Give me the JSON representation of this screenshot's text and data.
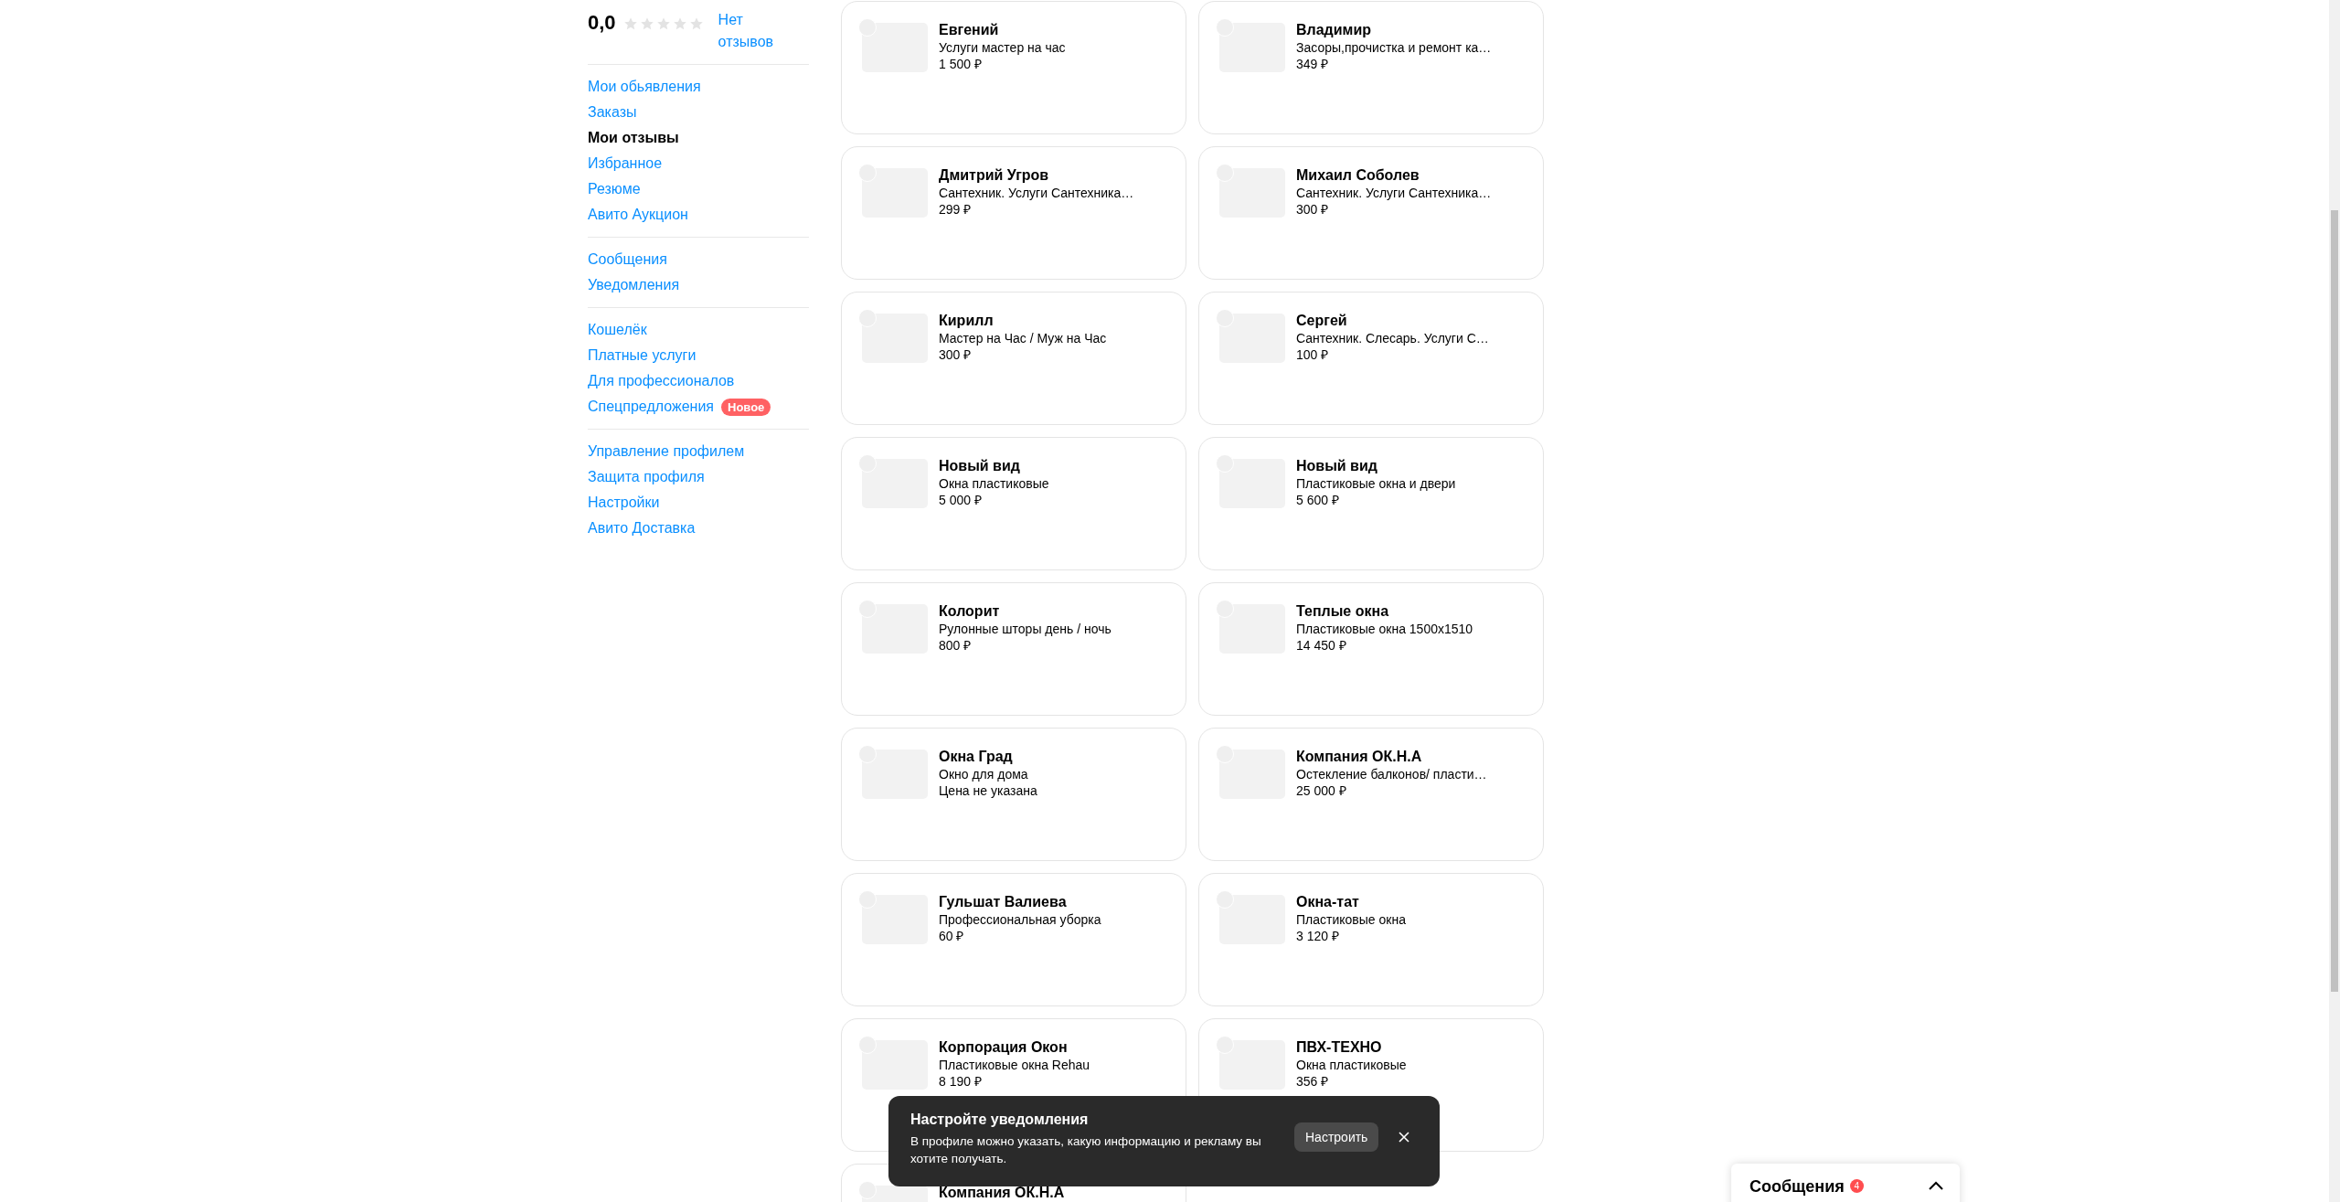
{
  "sidebar": {
    "rating": {
      "value": "0,0",
      "stars": 0,
      "link": "Нет отзывов"
    },
    "groups": [
      {
        "items": [
          {
            "label": "Мои обьявления",
            "selected": false
          },
          {
            "label": "Заказы",
            "selected": false
          },
          {
            "label": "Мои отзывы",
            "selected": true
          },
          {
            "label": "Избранное",
            "selected": false
          },
          {
            "label": "Резюме",
            "selected": false
          },
          {
            "label": "Авито Аукцион",
            "selected": false
          }
        ]
      },
      {
        "items": [
          {
            "label": "Сообщения",
            "selected": false
          },
          {
            "label": "Уведомления",
            "selected": false
          }
        ]
      },
      {
        "items": [
          {
            "label": "Кошелёк",
            "selected": false
          },
          {
            "label": "Платные услуги",
            "selected": false
          },
          {
            "label": "Для профессионалов",
            "selected": false
          },
          {
            "label": "Спецпредложения",
            "selected": false,
            "badge": "Новое"
          }
        ]
      },
      {
        "items": [
          {
            "label": "Управление профилем",
            "selected": false
          },
          {
            "label": "Защита профиля",
            "selected": false
          },
          {
            "label": "Настройки",
            "selected": false
          },
          {
            "label": "Авито Доставка",
            "selected": false
          }
        ]
      }
    ]
  },
  "listings": [
    {
      "name": "Евгений",
      "description": "Услуги мастер на час",
      "price": "1 500 ₽"
    },
    {
      "name": "Владимир",
      "description": "Засоры,прочистка и ремонт ка…",
      "price": "349 ₽"
    },
    {
      "name": "Дмитрий Угров",
      "description": "Сантехник. Услуги Сантехника…",
      "price": "299 ₽"
    },
    {
      "name": "Михаил Соболев",
      "description": "Сантехник. Услуги Сантехника…",
      "price": "300 ₽"
    },
    {
      "name": "Кирилл",
      "description": "Мастер на Час / Муж на Час",
      "price": "300 ₽"
    },
    {
      "name": "Сергей",
      "description": "Сантехник. Слесарь. Услуги С…",
      "price": "100 ₽"
    },
    {
      "name": "Новый вид",
      "description": "Окна пластиковые",
      "price": "5 000 ₽"
    },
    {
      "name": "Новый вид",
      "description": "Пластиковые окна и двери",
      "price": "5 600 ₽"
    },
    {
      "name": "Колорит",
      "description": "Рулонные шторы день / ночь",
      "price": "800 ₽"
    },
    {
      "name": "Теплые окна",
      "description": "Пластиковые окна 1500x1510",
      "price": "14 450 ₽"
    },
    {
      "name": "Окна Град",
      "description": "Окно для дома",
      "price": "Цена не указана"
    },
    {
      "name": "Компания ОК.Н.А",
      "description": "Остекление балконов/ пласти…",
      "price": "25 000 ₽"
    },
    {
      "name": "Гульшат Валиева",
      "description": "Профессиональная уборка",
      "price": "60 ₽"
    },
    {
      "name": "Окна-тат",
      "description": "Пластиковые окна",
      "price": "3 120 ₽"
    },
    {
      "name": "Корпорация Окон",
      "description": "Пластиковые окна Rehau",
      "price": "8 190 ₽"
    },
    {
      "name": "ПВХ-ТЕХНО",
      "description": "Окна пластиковые",
      "price": "356 ₽"
    },
    {
      "name": "Компания ОК.Н.А"
    }
  ],
  "toast": {
    "title": "Настройте уведомления",
    "text": "В профиле можно указать, какую информацию и рекламу вы хотите получать.",
    "button": "Настроить"
  },
  "messages_bar": {
    "label": "Сообщения",
    "count": "4"
  }
}
